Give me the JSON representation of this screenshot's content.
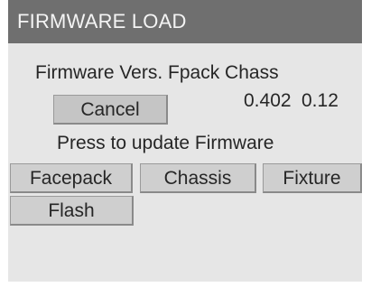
{
  "header": {
    "title": "FIRMWARE LOAD"
  },
  "firmware": {
    "heading": "Firmware Vers. Fpack Chass",
    "fpack_version": "0.402",
    "chass_version": "0.12"
  },
  "buttons": {
    "cancel": "Cancel",
    "facepack": "Facepack",
    "chassis": "Chassis",
    "fixture": "Fixture",
    "flash": "Flash"
  },
  "prompt": "Press to update Firmware"
}
